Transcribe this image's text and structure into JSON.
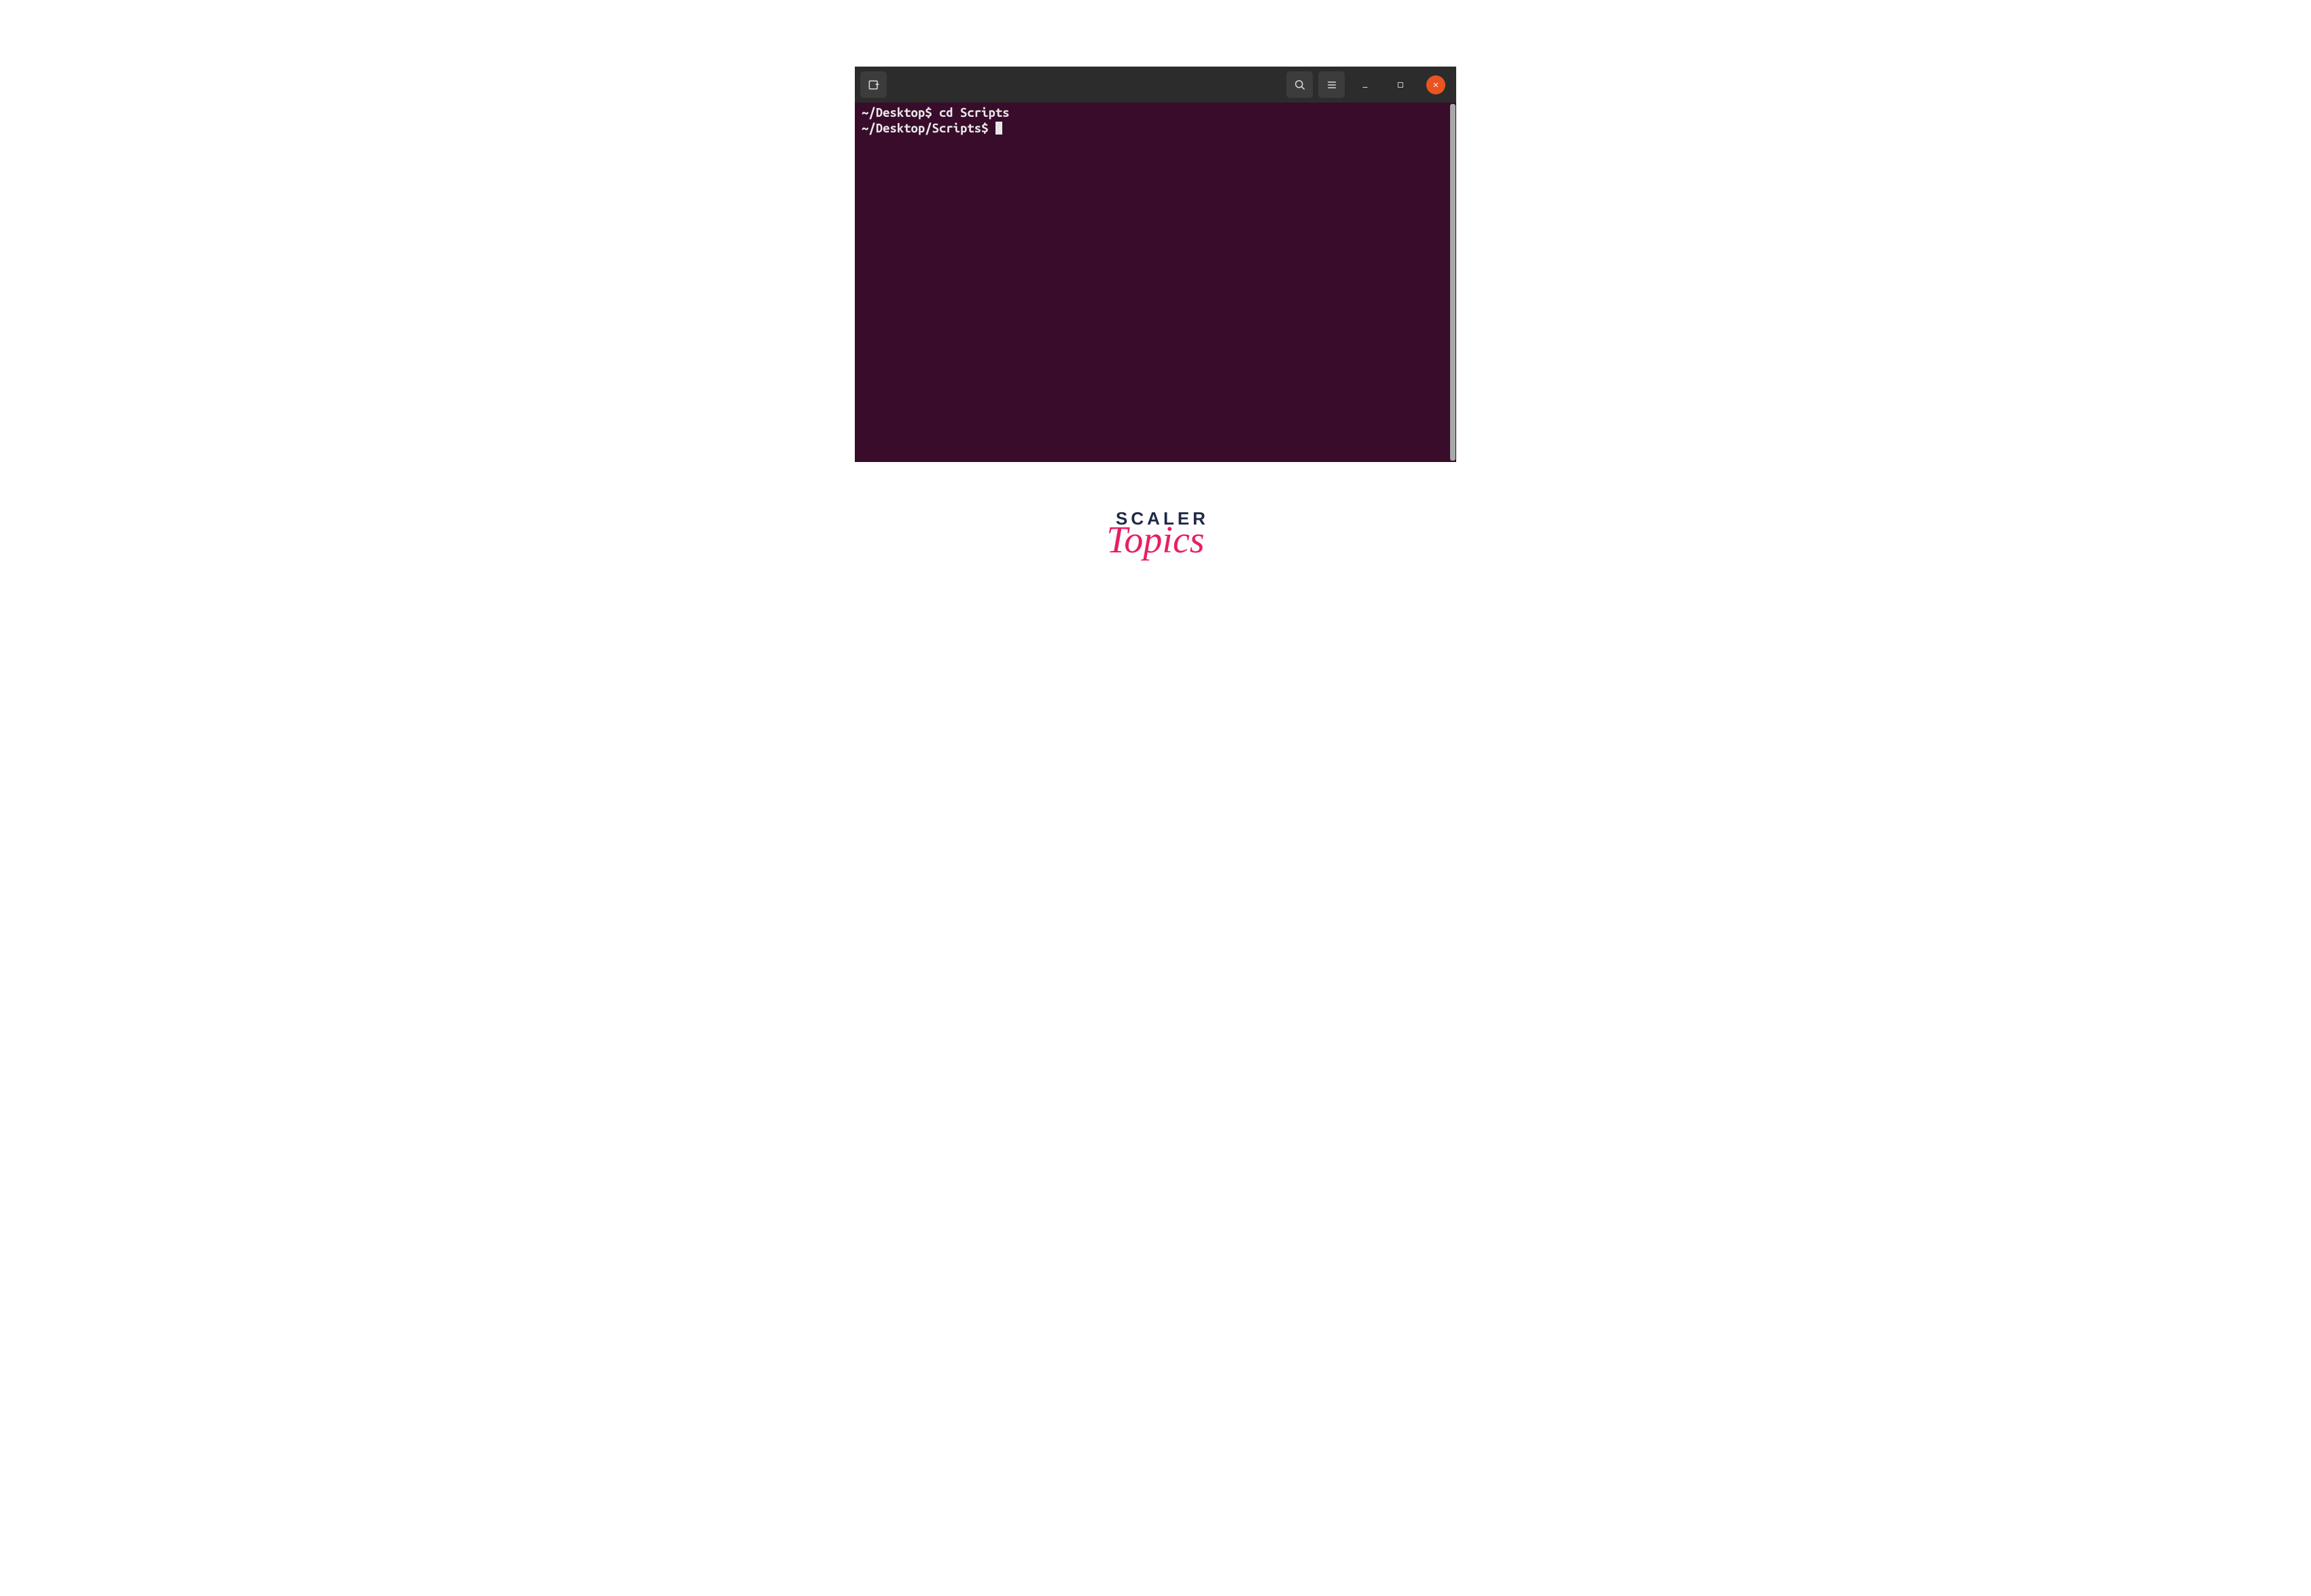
{
  "terminal": {
    "lines": [
      {
        "prompt": "~/Desktop$ ",
        "command": "cd Scripts"
      },
      {
        "prompt": "~/Desktop/Scripts$ ",
        "command": ""
      }
    ]
  },
  "logo": {
    "line1": "SCALER",
    "line2": "Topics"
  },
  "colors": {
    "terminalBg": "#380c2a",
    "titlebarBg": "#2c2c2c",
    "closeBtnBg": "#e95420",
    "logoDark": "#1e2a45",
    "logoPink": "#e91e63"
  }
}
